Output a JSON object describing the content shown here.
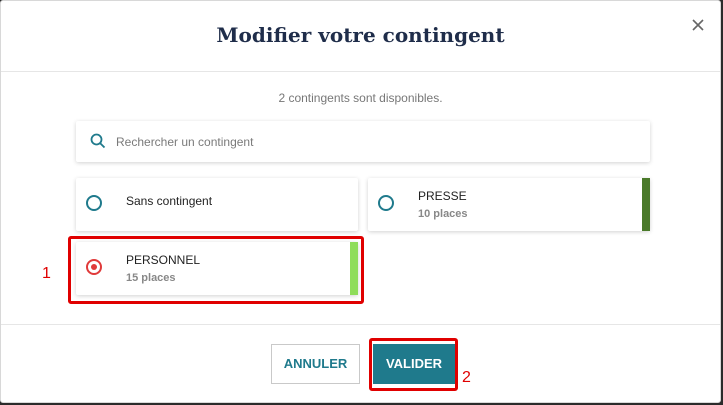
{
  "dialog": {
    "title": "Modifier votre contingent",
    "subtitle": "2 contingents sont disponibles."
  },
  "search": {
    "placeholder": "Rechercher un contingent"
  },
  "options": [
    {
      "name": "Sans contingent",
      "count": "",
      "selected": false,
      "color": ""
    },
    {
      "name": "PRESSE",
      "count": "10 places",
      "selected": false,
      "color": "#4a7a2a"
    },
    {
      "name": "PERSONNEL",
      "count": "15 places",
      "selected": true,
      "color": "#8fdd5a"
    }
  ],
  "annotations": {
    "step1": "1",
    "step2": "2"
  },
  "buttons": {
    "cancel": "ANNULER",
    "validate": "VALIDER"
  },
  "colors": {
    "accent": "#1f7a8c",
    "highlight": "#e00000",
    "title": "#1f2d4a"
  }
}
